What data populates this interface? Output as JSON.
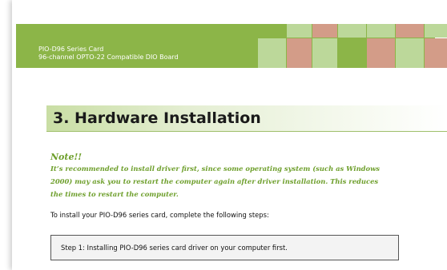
{
  "header": {
    "product_line": "PIO-D96 Series Card",
    "product_desc": "96-channel OPTO-22 Compatible DIO Board"
  },
  "section": {
    "title": "3.  Hardware Installation"
  },
  "note": {
    "heading": "Note!!",
    "lines": [
      "It’s recommended to install driver first, since some operating system (such as Windows",
      "2000) may ask you to restart the computer again after driver installation. This reduces",
      "the times to restart the computer."
    ]
  },
  "intro": "To install your PIO-D96 series card, complete the following steps:",
  "steps": [
    "Step 1: Installing PIO-D96 series card driver on your computer first."
  ],
  "colors": {
    "header_green": "#8cb548",
    "tile_light_green": "#bcd89a",
    "tile_pink": "#d39c88",
    "note_green": "#6e9f2c"
  }
}
